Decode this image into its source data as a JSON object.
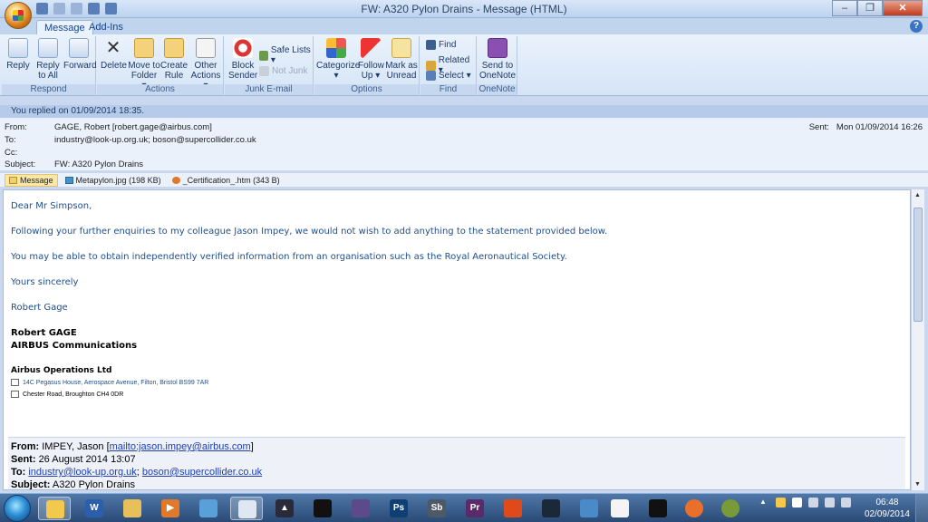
{
  "window": {
    "title": "FW: A320 Pylon Drains - Message (HTML)"
  },
  "tabs": [
    "Message",
    "Add-Ins"
  ],
  "ribbon": {
    "respond": {
      "label": "Respond",
      "reply": "Reply",
      "reply_all_1": "Reply",
      "reply_all_2": "to All",
      "forward": "Forward"
    },
    "actions": {
      "label": "Actions",
      "delete": "Delete",
      "move_1": "Move to",
      "move_2": "Folder ▾",
      "rule_1": "Create",
      "rule_2": "Rule",
      "other_1": "Other",
      "other_2": "Actions ▾"
    },
    "junk": {
      "label": "Junk E-mail",
      "block_1": "Block",
      "block_2": "Sender",
      "safe_lists": "Safe Lists ▾",
      "not_junk": "Not Junk"
    },
    "options": {
      "label": "Options",
      "categorize_1": "Categorize",
      "categorize_2": "▾",
      "follow_1": "Follow",
      "follow_2": "Up ▾",
      "mark_1": "Mark as",
      "mark_2": "Unread"
    },
    "find": {
      "label": "Find",
      "find": "Find",
      "related": "Related ▾",
      "select": "Select ▾"
    },
    "onenote": {
      "label": "OneNote",
      "send_1": "Send to",
      "send_2": "OneNote"
    }
  },
  "infobar": "You replied on 01/09/2014 18:35.",
  "header": {
    "from_label": "From:",
    "from": "GAGE, Robert [robert.gage@airbus.com]",
    "to_label": "To:",
    "to": "industry@look-up.org.uk; boson@supercollider.co.uk",
    "cc_label": "Cc:",
    "cc": "",
    "subject_label": "Subject:",
    "subject": "FW: A320 Pylon Drains",
    "sent_label": "Sent:",
    "sent": "Mon 01/09/2014 16:26"
  },
  "attachments": [
    {
      "name": "Message"
    },
    {
      "name": "Metapylon.jpg (198 KB)"
    },
    {
      "name": "_Certification_.htm (343 B)"
    }
  ],
  "body": {
    "greeting": "Dear Mr Simpson,",
    "p1": "Following your further enquiries to my colleague Jason Impey, we would not wish to add anything to the statement provided below.",
    "p2": "You may be able to obtain independently verified information from an organisation such as the Royal Aeronautical Society.",
    "closing": "Yours sincerely",
    "signature": "Robert Gage",
    "sig_name": "Robert GAGE",
    "sig_dept": "AIRBUS Communications",
    "company": "Airbus Operations Ltd",
    "addr1": "14C Pegasus House, Aerospace Avenue, Filton, Bristol BS99 7AR",
    "addr2": "Chester Road, Broughton CH4 0DR"
  },
  "quoted": {
    "from_label": "From:",
    "from": "IMPEY, Jason [",
    "from_link": "mailto:jason.impey@airbus.com",
    "from_end": "]",
    "sent_label": "Sent:",
    "sent": "26 August 2014 13:07",
    "to_label": "To:",
    "to_link1": "industry@look-up.org.uk",
    "to_sep": "; ",
    "to_link2": "boson@supercollider.co.uk",
    "subject_label": "Subject:",
    "subject": "A320 Pylon Drains"
  },
  "taskbar": {
    "ps": "Ps",
    "sb": "Sb",
    "pr": "Pr",
    "time": "06:48",
    "date": "02/09/2014"
  },
  "colors": {
    "accent": "#15428b",
    "body_text": "#1f4e8c",
    "link": "#1f3fae"
  }
}
